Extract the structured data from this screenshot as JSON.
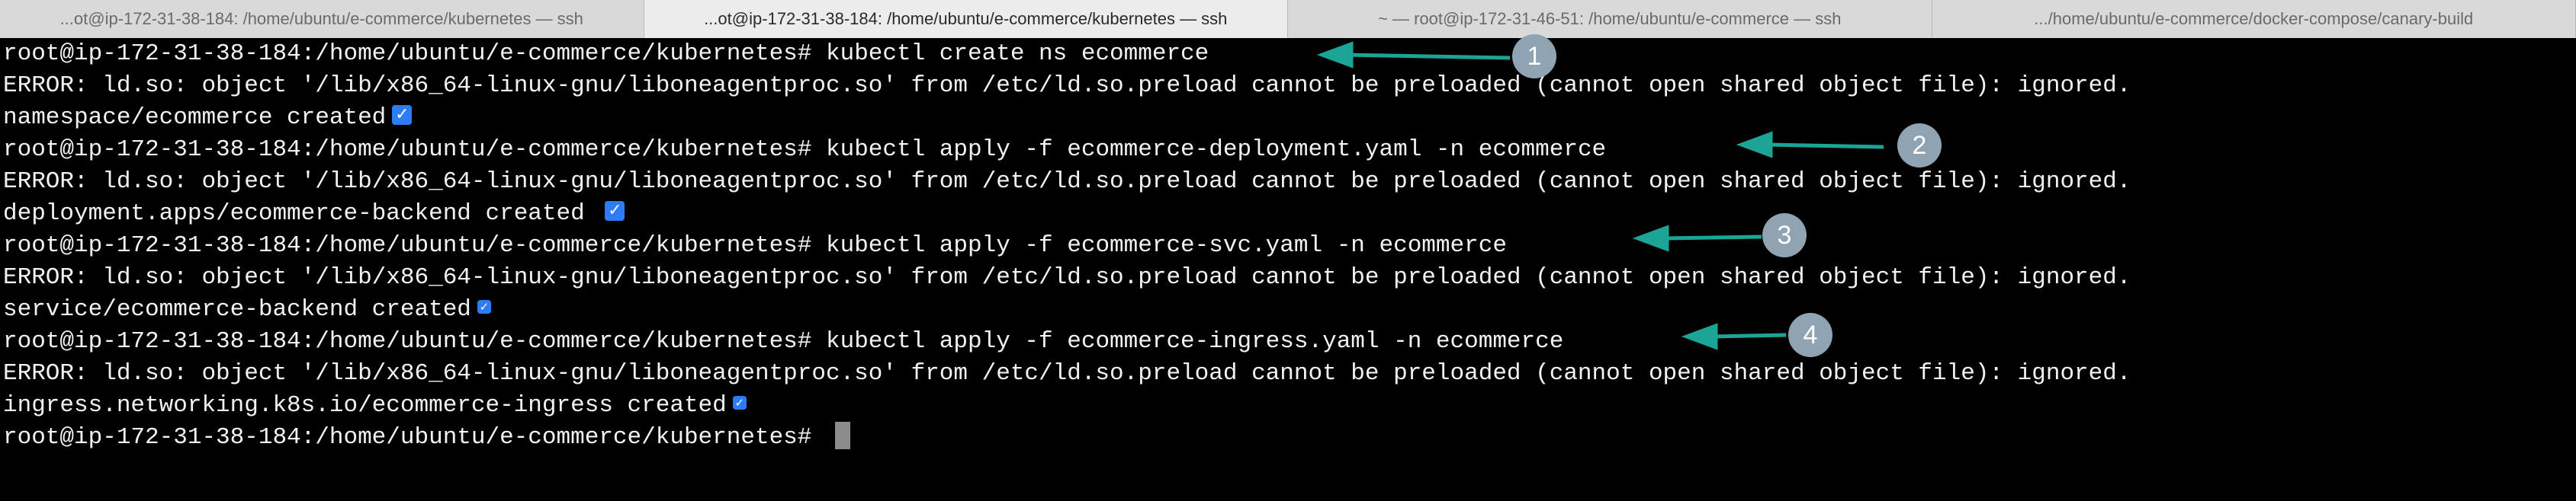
{
  "tabs": [
    {
      "label": "...ot@ip-172-31-38-184: /home/ubuntu/e-commerce/kubernetes — ssh",
      "active": false
    },
    {
      "label": "...ot@ip-172-31-38-184: /home/ubuntu/e-commerce/kubernetes — ssh",
      "active": true
    },
    {
      "label": "~ — root@ip-172-31-46-51: /home/ubuntu/e-commerce — ssh",
      "active": false
    },
    {
      "label": ".../home/ubuntu/e-commerce/docker-compose/canary-build",
      "active": false
    }
  ],
  "terminal": {
    "prompt": "root@ip-172-31-38-184:/home/ubuntu/e-commerce/kubernetes# ",
    "lines": [
      {
        "kind": "command",
        "text": "kubectl create ns ecommerce"
      },
      {
        "kind": "error",
        "text": "ERROR: ld.so: object '/lib/x86_64-linux-gnu/liboneagentproc.so' from /etc/ld.so.preload cannot be preloaded (cannot open shared object file): ignored."
      },
      {
        "kind": "output",
        "text": "namespace/ecommerce created"
      },
      {
        "kind": "command",
        "text": "kubectl apply -f ecommerce-deployment.yaml -n ecommerce"
      },
      {
        "kind": "error",
        "text": "ERROR: ld.so: object '/lib/x86_64-linux-gnu/liboneagentproc.so' from /etc/ld.so.preload cannot be preloaded (cannot open shared object file): ignored."
      },
      {
        "kind": "output",
        "text": "deployment.apps/ecommerce-backend created "
      },
      {
        "kind": "command",
        "text": "kubectl apply -f ecommerce-svc.yaml -n ecommerce"
      },
      {
        "kind": "error",
        "text": "ERROR: ld.so: object '/lib/x86_64-linux-gnu/liboneagentproc.so' from /etc/ld.so.preload cannot be preloaded (cannot open shared object file): ignored."
      },
      {
        "kind": "output",
        "text": "service/ecommerce-backend created"
      },
      {
        "kind": "command",
        "text": "kubectl apply -f ecommerce-ingress.yaml -n ecommerce"
      },
      {
        "kind": "error",
        "text": "ERROR: ld.so: object '/lib/x86_64-linux-gnu/liboneagentproc.so' from /etc/ld.so.preload cannot be preloaded (cannot open shared object file): ignored."
      },
      {
        "kind": "output",
        "text": "ingress.networking.k8s.io/ecommerce-ingress created"
      },
      {
        "kind": "prompt-only",
        "text": ""
      }
    ]
  },
  "checkmark_icon": "check-mark-icon",
  "annotations": {
    "badges": [
      "1",
      "2",
      "3",
      "4"
    ],
    "arrow_color": "#1aa596",
    "badge_color": "#8fa3b2"
  },
  "colors": {
    "terminal_bg": "#000000",
    "terminal_fg": "#f2f2f2",
    "check_bg": "#2d7cf6"
  }
}
